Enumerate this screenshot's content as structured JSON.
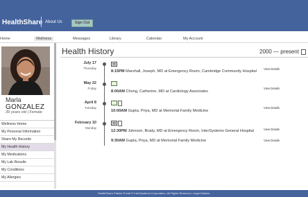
{
  "header": {
    "brand": "HealthShare",
    "about": "About Us",
    "signout": "Sign Out"
  },
  "nav": [
    "Home",
    "Wellness",
    "Messages",
    "Library",
    "Calendar",
    "My Account"
  ],
  "profile": {
    "first_name": "Marla",
    "last_name": "GONZALEZ",
    "meta": "39 years old | Female"
  },
  "side_menu": [
    "Wellness Home",
    "My Personal Information",
    "Share My Records",
    "My Health History",
    "My Medications",
    "My Lab Results",
    "My Conditions",
    "My Allergies"
  ],
  "main": {
    "title": "Health History",
    "range": "2000 — present"
  },
  "timeline": [
    {
      "date": "July 17",
      "day": "Thursday",
      "entries": [
        {
          "time": "8:15PM",
          "text": "Marshall, Joseph, MD at Emergency Room, Cambridge Community Hospital",
          "link": "View Details"
        }
      ]
    },
    {
      "date": "May 22",
      "day": "Friday",
      "entries": [
        {
          "time": "8:00AM",
          "text": "Chong, Catherine, MD at Cardiology Associates",
          "link": "View Details"
        }
      ]
    },
    {
      "date": "April 8",
      "day": "Tuesday",
      "entries": [
        {
          "time": "10:00AM",
          "text": "Gupta, Priya, MD at Memorial Family Medicine",
          "link": "View Details"
        }
      ]
    },
    {
      "date": "February 10",
      "day": "Monday",
      "entries": [
        {
          "time": "12:30PM",
          "text": "Johnson, Brady, MD at Emergency Room, InterSystems General Hospital",
          "link": "View Details"
        },
        {
          "time": "9:30AM",
          "text": "Gupta, Priya, MD at Memorial Family Medicine",
          "link": "View Details"
        }
      ]
    }
  ],
  "footer": {
    "text": "HealthShare Patient Portal © InterSystems Corporation. All Rights Reserved. Legal Notices."
  },
  "colors": {
    "header_bg": "#44639c",
    "signout_bg": "#a6c8c0",
    "active_menu": "#e3dce8"
  }
}
